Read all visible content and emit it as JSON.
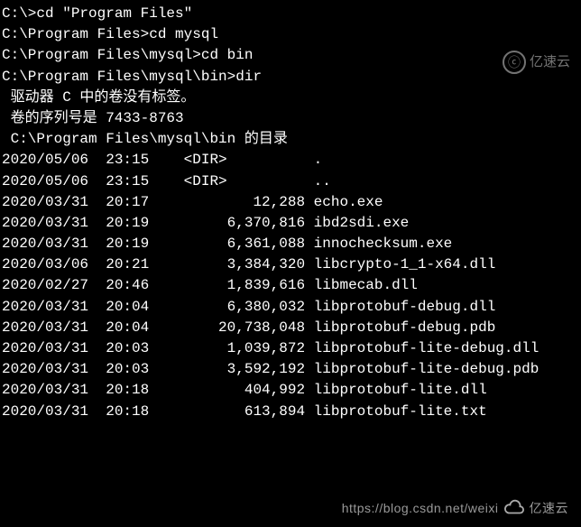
{
  "commands": [
    {
      "prompt": "C:\\>",
      "cmd": "cd \"Program Files\""
    },
    {
      "prompt": "C:\\Program Files>",
      "cmd": "cd mysql"
    },
    {
      "prompt": "C:\\Program Files\\mysql>",
      "cmd": "cd bin"
    },
    {
      "prompt": "C:\\Program Files\\mysql\\bin>",
      "cmd": "dir"
    }
  ],
  "volume_info": {
    "line1": " 驱动器 C 中的卷没有标签。",
    "line2": " 卷的序列号是 7433-8763"
  },
  "dir_header": " C:\\Program Files\\mysql\\bin 的目录",
  "entries": [
    {
      "date": "2020/05/06",
      "time": "23:15",
      "size": "<DIR>         ",
      "name": "."
    },
    {
      "date": "2020/05/06",
      "time": "23:15",
      "size": "<DIR>         ",
      "name": ".."
    },
    {
      "date": "2020/03/31",
      "time": "20:17",
      "size": "        12,288",
      "name": "echo.exe"
    },
    {
      "date": "2020/03/31",
      "time": "20:19",
      "size": "     6,370,816",
      "name": "ibd2sdi.exe"
    },
    {
      "date": "2020/03/31",
      "time": "20:19",
      "size": "     6,361,088",
      "name": "innochecksum.exe"
    },
    {
      "date": "2020/03/06",
      "time": "20:21",
      "size": "     3,384,320",
      "name": "libcrypto-1_1-x64.dll"
    },
    {
      "date": "2020/02/27",
      "time": "20:46",
      "size": "     1,839,616",
      "name": "libmecab.dll"
    },
    {
      "date": "2020/03/31",
      "time": "20:04",
      "size": "     6,380,032",
      "name": "libprotobuf-debug.dll"
    },
    {
      "date": "2020/03/31",
      "time": "20:04",
      "size": "    20,738,048",
      "name": "libprotobuf-debug.pdb"
    },
    {
      "date": "2020/03/31",
      "time": "20:03",
      "size": "     1,039,872",
      "name": "libprotobuf-lite-debug.dll"
    },
    {
      "date": "2020/03/31",
      "time": "20:03",
      "size": "     3,592,192",
      "name": "libprotobuf-lite-debug.pdb"
    },
    {
      "date": "2020/03/31",
      "time": "20:18",
      "size": "       404,992",
      "name": "libprotobuf-lite.dll"
    },
    {
      "date": "2020/03/31",
      "time": "20:18",
      "size": "       613,894",
      "name": "libprotobuf-lite.txt"
    }
  ],
  "watermark": {
    "symbol": "ⓒ",
    "text": "亿速云"
  },
  "footer_watermark": {
    "url": "https://blog.csdn.net/weixi",
    "brand": "亿速云"
  }
}
